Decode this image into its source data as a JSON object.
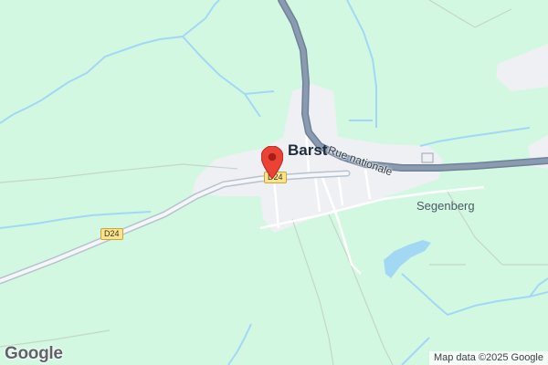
{
  "map": {
    "place_labels": {
      "town": "Barst",
      "village": "Segenberg"
    },
    "road_labels": {
      "main_road": "Rue nationale"
    },
    "route_shields": {
      "west": "D24",
      "center": "D24"
    },
    "marker": {
      "icon": "location-pin-icon",
      "color": "#ea4335"
    },
    "branding": {
      "logo": "Google"
    },
    "attribution": "Map data ©2025 Google",
    "colors": {
      "land": "#d3f8e2",
      "settlement": "#eef0f3",
      "water": "#a3d8f5",
      "main_road": "#8a9bb0",
      "minor_road": "#ffffff",
      "shield": "#fce38a"
    }
  }
}
